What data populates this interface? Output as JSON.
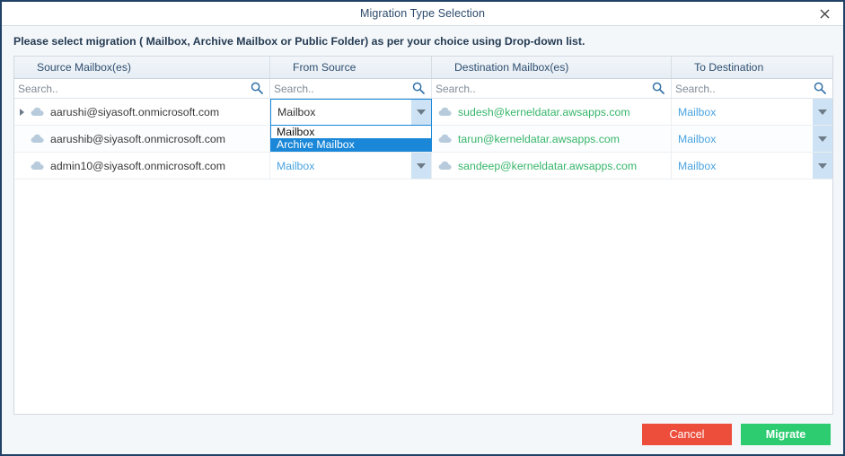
{
  "window": {
    "title": "Migration Type Selection",
    "close_icon": "close-icon"
  },
  "instruction": {
    "text": "Please select migration ( Mailbox, Archive Mailbox or Public Folder) as per your choice using Drop-down list."
  },
  "grid": {
    "columns": [
      {
        "header": "Source Mailbox(es)",
        "search_placeholder": "Search.."
      },
      {
        "header": "From Source",
        "search_placeholder": "Search.."
      },
      {
        "header": "Destination Mailbox(es)",
        "search_placeholder": "Search.."
      },
      {
        "header": "To Destination",
        "search_placeholder": "Search.."
      }
    ],
    "rows": [
      {
        "source_mailbox": "aarushi@siyasoft.onmicrosoft.com",
        "from_source": "Mailbox",
        "destination_mailbox": "sudesh@kerneldatar.awsapps.com",
        "to_destination": "Mailbox",
        "expandable": true
      },
      {
        "source_mailbox": "aarushib@siyasoft.onmicrosoft.com",
        "from_source": "Mailbox",
        "destination_mailbox": "tarun@kerneldatar.awsapps.com",
        "to_destination": "Mailbox",
        "expandable": false
      },
      {
        "source_mailbox": "admin10@siyasoft.onmicrosoft.com",
        "from_source": "Mailbox",
        "destination_mailbox": "sandeep@kerneldatar.awsapps.com",
        "to_destination": "Mailbox",
        "expandable": false
      }
    ]
  },
  "open_dropdown": {
    "row_index": 0,
    "column": "from_source",
    "current_value": "Mailbox",
    "options": [
      "Mailbox",
      "Archive Mailbox"
    ],
    "highlighted_option": "Archive Mailbox"
  },
  "footer": {
    "cancel_label": "Cancel",
    "migrate_label": "Migrate"
  },
  "colors": {
    "window_border": "#1f4266",
    "title_text": "#2a4a6b",
    "panel_background": "#f4f7fa",
    "header_gradient_top": "#f2f6fa",
    "header_gradient_bottom": "#e6edf4",
    "dropdown_focus_border": "#1a87d8",
    "dropdown_highlight": "#1a87d8",
    "dropdown_button_fill": "#cde3f5",
    "destination_text": "#36b56a",
    "combo_text_blue": "#4aa3e0",
    "cancel_button": "#ed4e3c",
    "migrate_button": "#2ecc71",
    "search_icon": "#2f6fa8",
    "cloud_icon": "#b8cbdc"
  }
}
